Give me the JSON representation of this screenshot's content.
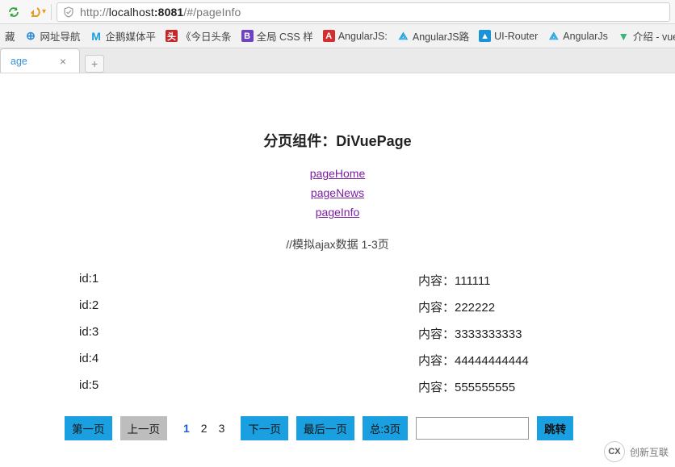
{
  "browser": {
    "url_prefix": "http://",
    "url_host": "localhost",
    "url_port": ":8081",
    "url_path": "/#/pageInfo"
  },
  "bookmarks": {
    "fav": "藏",
    "nav": "网址导航",
    "qie": "企鹅媒体平",
    "toutiao": "《今日头条",
    "css": "全局 CSS 样",
    "ang1": "AngularJS:",
    "ang2": "AngularJS路",
    "ui": "UI-Router",
    "ang3": "AngularJs",
    "vue": "介绍 - vue"
  },
  "tab": {
    "label": "age"
  },
  "page": {
    "title": "分页组件：DiVuePage",
    "links": [
      "pageHome",
      "pageNews",
      "pageInfo"
    ],
    "info": "//模拟ajax数据 1-3页",
    "rows": [
      {
        "id": "id:1",
        "content": "内容：111111"
      },
      {
        "id": "id:2",
        "content": "内容：222222"
      },
      {
        "id": "id:3",
        "content": "内容：3333333333"
      },
      {
        "id": "id:4",
        "content": "内容：44444444444"
      },
      {
        "id": "id:5",
        "content": "内容：555555555"
      }
    ],
    "pager": {
      "first": "第一页",
      "prev": "上一页",
      "pages": [
        "1",
        "2",
        "3"
      ],
      "current": 0,
      "next": "下一页",
      "last": "最后一页",
      "total": "总:3页",
      "jump_value": "",
      "jump_btn": "跳转"
    }
  },
  "watermark": {
    "text": "创新互联",
    "logo": "CX"
  }
}
